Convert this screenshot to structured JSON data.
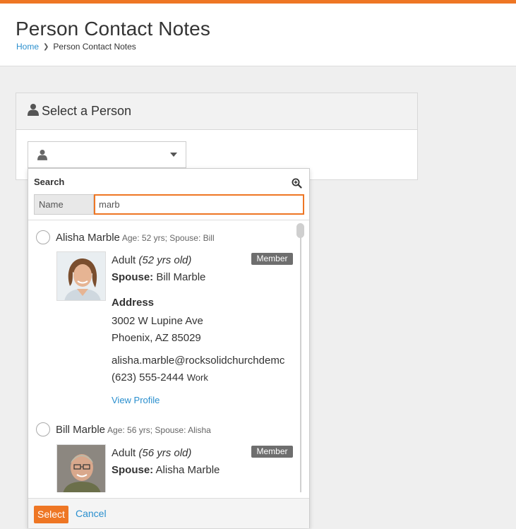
{
  "colors": {
    "accent": "#ee7624",
    "link": "#2a8fce",
    "badge": "#6e6e6e"
  },
  "header": {
    "title": "Person Contact Notes",
    "breadcrumb": {
      "home": "Home",
      "current": "Person Contact Notes"
    }
  },
  "panel": {
    "title": "Select a Person",
    "icon": "user-icon"
  },
  "picker": {
    "search_label": "Search",
    "name_addon": "Name",
    "name_value": "marb",
    "select_label": "Select",
    "cancel_label": "Cancel"
  },
  "results": [
    {
      "name": "Alisha Marble",
      "meta": "Age: 52 yrs; Spouse: Bill",
      "badge": "Member",
      "role": "Adult",
      "age": "(52 yrs old)",
      "spouse_label": "Spouse:",
      "spouse": "Bill Marble",
      "address_label": "Address",
      "street": "3002 W Lupine Ave",
      "city": "Phoenix, AZ 85029",
      "email": "alisha.marble@rocksolidchurchdemc",
      "phone": "(623) 555-2444",
      "phone_type": "Work",
      "view_profile": "View Profile"
    },
    {
      "name": "Bill Marble",
      "meta": "Age: 56 yrs; Spouse: Alisha",
      "badge": "Member",
      "role": "Adult",
      "age": "(56 yrs old)",
      "spouse_label": "Spouse:",
      "spouse": "Alisha Marble"
    }
  ]
}
